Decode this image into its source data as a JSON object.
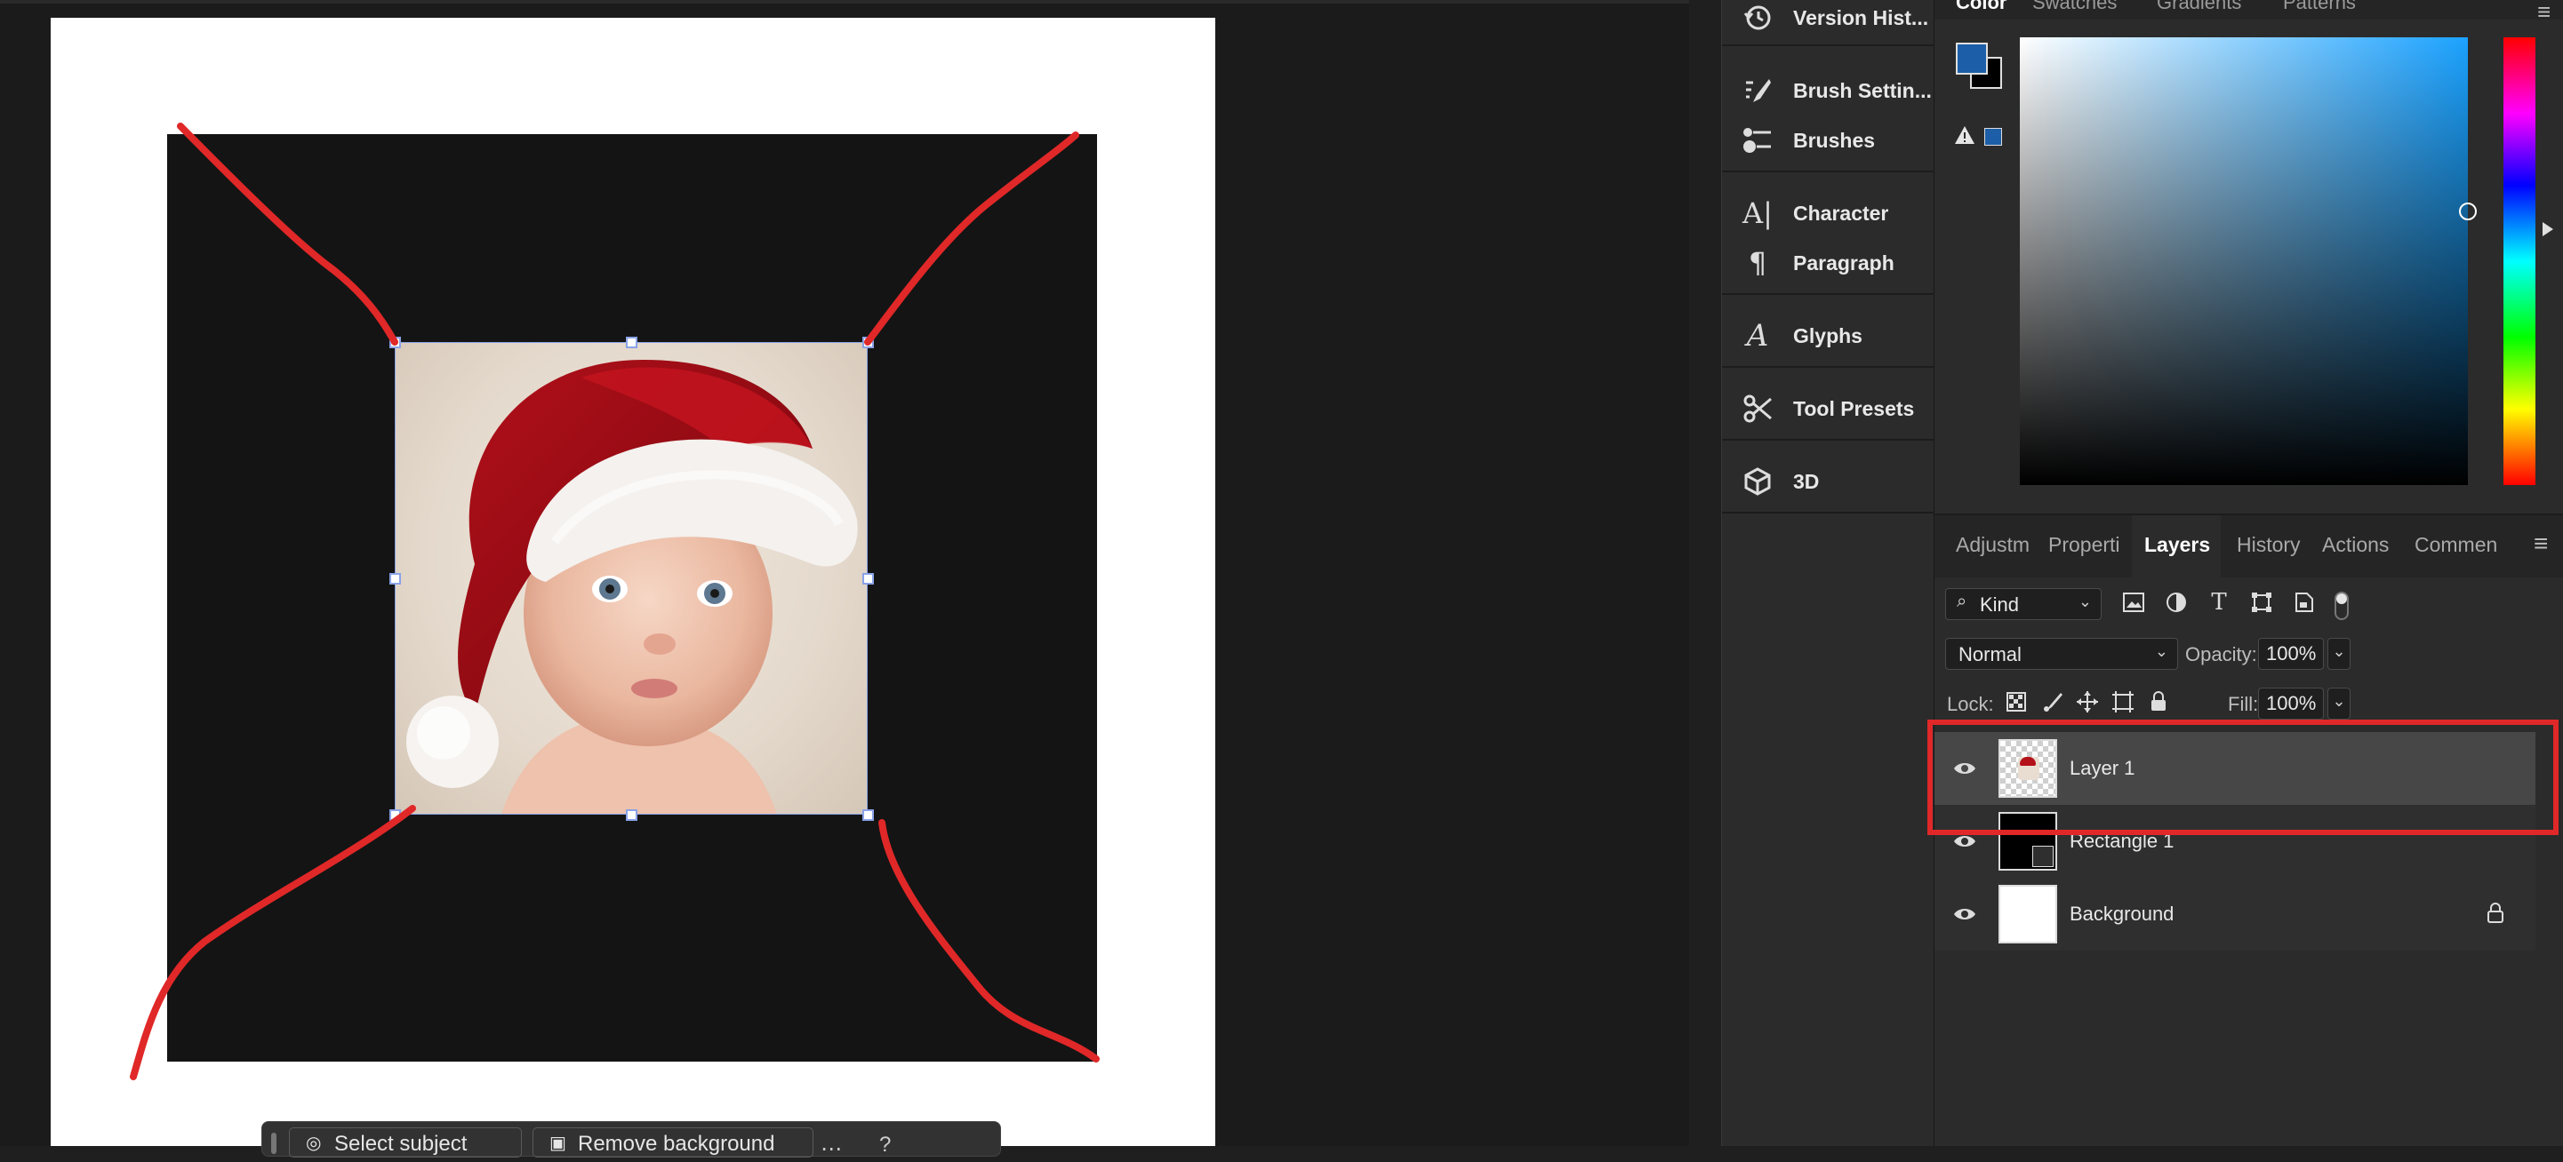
{
  "panel_column": {
    "items": [
      {
        "label": "Version Hist...",
        "icon": "history-clock-icon"
      },
      {
        "label": "Brush Settin...",
        "icon": "brush-settings-icon"
      },
      {
        "label": "Brushes",
        "icon": "brushes-icon"
      },
      {
        "label": "Character",
        "icon": "character-icon"
      },
      {
        "label": "Paragraph",
        "icon": "paragraph-icon"
      },
      {
        "label": "Glyphs",
        "icon": "glyphs-icon"
      },
      {
        "label": "Tool Presets",
        "icon": "tool-presets-icon"
      },
      {
        "label": "3D",
        "icon": "cube-3d-icon"
      }
    ]
  },
  "color_panel": {
    "tabs": [
      "Color",
      "Swatches",
      "Gradients",
      "Patterns"
    ],
    "foreground_color": "#1c5fa8",
    "background_color": "#000000",
    "hue_base": "#1ba2ff"
  },
  "layers_panel": {
    "tabs": [
      "Adjustm",
      "Properti",
      "Layers",
      "History",
      "Actions",
      "Commen"
    ],
    "active_tab": "Layers",
    "filter_kind": "Kind",
    "blend_mode": "Normal",
    "opacity_label": "Opacity:",
    "opacity_value": "100%",
    "lock_label": "Lock:",
    "fill_label": "Fill:",
    "fill_value": "100%",
    "layers": [
      {
        "name": "Layer 1",
        "selected": true,
        "thumb": "photo"
      },
      {
        "name": "Rectangle 1",
        "selected": false,
        "thumb": "shape"
      },
      {
        "name": "Background",
        "selected": false,
        "thumb": "white",
        "locked": true
      }
    ]
  },
  "contextual_bar": {
    "buttons": [
      "Select subject",
      "Remove background"
    ]
  },
  "annotation_color": "#e02828"
}
